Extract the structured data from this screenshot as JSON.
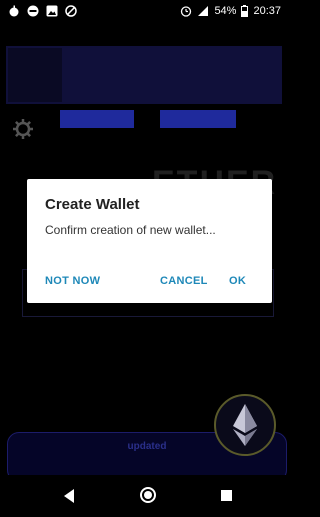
{
  "status_bar": {
    "battery": "54%",
    "time": "20:37"
  },
  "app": {
    "tab1_label": "",
    "tab2_label": "",
    "brand_text": "ETHER",
    "bottom_card": {
      "title": "updated",
      "subtitle": ""
    }
  },
  "dialog": {
    "title": "Create Wallet",
    "message": "Confirm creation of new wallet...",
    "buttons": {
      "not_now": "NOT NOW",
      "cancel": "CANCEL",
      "ok": "OK"
    }
  },
  "colors": {
    "accent": "#1e88b8",
    "dialog_bg": "#ffffff",
    "app_bg": "#000000"
  }
}
